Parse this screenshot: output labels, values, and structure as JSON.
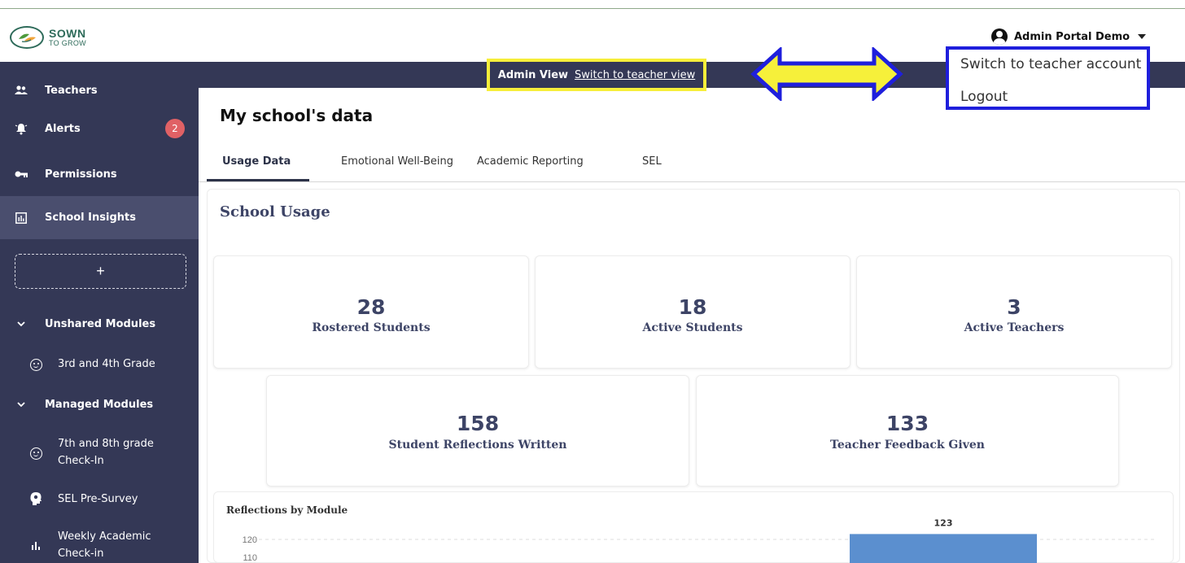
{
  "brand": {
    "line1": "SOWN",
    "line2": "TO GROW"
  },
  "user_menu": {
    "name": "Admin Portal Demo",
    "icon": "user-circle-icon"
  },
  "admin_bar": {
    "label": "Admin View",
    "link": "Switch to teacher view"
  },
  "dropdown": {
    "items": [
      "Switch to teacher account",
      "Logout"
    ]
  },
  "annotation_colors": {
    "highlight_box": "#f6ee3a",
    "arrow_fill": "#f6f03a",
    "arrow_stroke": "#1f1fdc",
    "dropdown_border": "#1f1fdc"
  },
  "sidebar": {
    "items": [
      {
        "label": "Teachers",
        "icon": "users-icon"
      },
      {
        "label": "Alerts",
        "icon": "alert-icon",
        "badge": "2"
      },
      {
        "label": "Permissions",
        "icon": "key-icon"
      },
      {
        "label": "School Insights",
        "icon": "bar-chart-icon"
      }
    ],
    "add_label": "+",
    "sections": [
      {
        "label": "Unshared Modules",
        "items": [
          {
            "label": "3rd and 4th Grade"
          }
        ]
      },
      {
        "label": "Managed Modules",
        "items": [
          {
            "label_l1": "7th and 8th grade",
            "label_l2": "Check-In"
          },
          {
            "label": "SEL Pre-Survey"
          },
          {
            "label_l1": "Weekly Academic",
            "label_l2": "Check-in"
          }
        ]
      }
    ]
  },
  "main": {
    "title": "My school's data",
    "tabs": [
      "Usage Data",
      "Emotional Well-Being",
      "Academic Reporting",
      "SEL"
    ],
    "section_title": "School Usage",
    "stats": [
      {
        "value": "28",
        "label": "Rostered Students"
      },
      {
        "value": "18",
        "label": "Active Students"
      },
      {
        "value": "3",
        "label": "Active Teachers"
      },
      {
        "value": "158",
        "label": "Student Reflections Written"
      },
      {
        "value": "133",
        "label": "Teacher Feedback Given"
      }
    ]
  },
  "chart_data": {
    "type": "bar",
    "title": "Reflections by Module",
    "y_ticks_visible": [
      "120",
      "110"
    ],
    "bars": [
      {
        "value": 123,
        "label": "123",
        "color": "#5b8fcf"
      }
    ]
  }
}
